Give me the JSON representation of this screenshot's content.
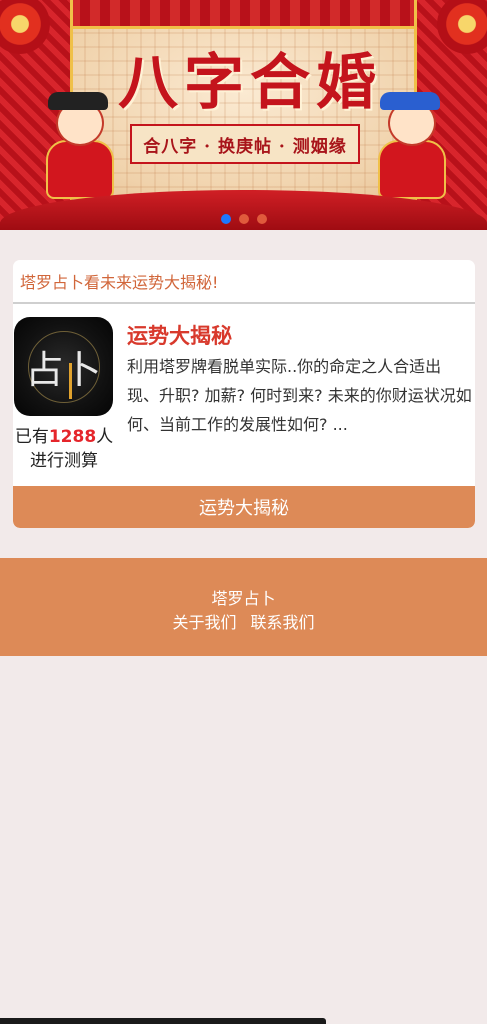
{
  "banner": {
    "title": "八字合婚",
    "subtitle": "合八字 · 换庚帖 · 测姻缘",
    "slide_count": 3,
    "active_slide": 0
  },
  "card": {
    "header": "塔罗占卜看未来运势大揭秘!",
    "icon_glyph": "占卜",
    "count_prefix": "已有",
    "count_number": "1288",
    "count_suffix": "人",
    "count_line2": "进行测算",
    "title": "运势大揭秘",
    "description": "利用塔罗牌看脱单实际..你的命定之人合适出现、升职? 加薪? 何时到来? 未来的你财运状况如何、当前工作的发展性如何? ...",
    "button_label": "运势大揭秘"
  },
  "footer": {
    "brand": "塔罗占卜",
    "links": [
      "关于我们",
      "联系我们"
    ]
  },
  "colors": {
    "accent": "#dd8a57",
    "header_text": "#d1663a",
    "title_red": "#d8392c",
    "count_red": "#e5252b",
    "page_bg": "#f2eaea",
    "dot_active": "#1e78ff"
  }
}
